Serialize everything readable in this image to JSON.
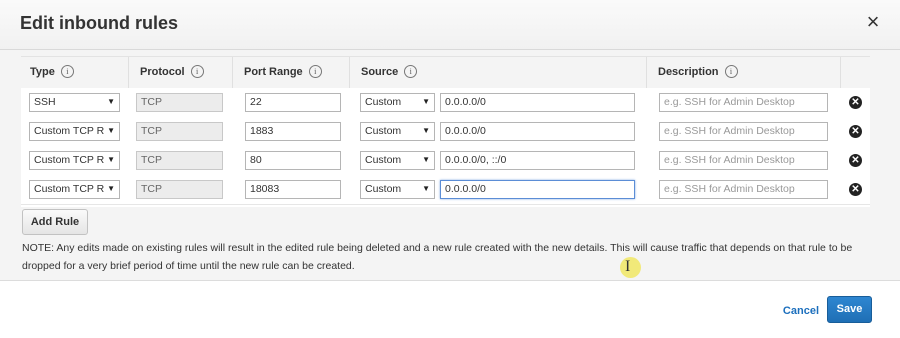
{
  "dialog": {
    "title": "Edit inbound rules",
    "close_icon": "close-icon"
  },
  "table": {
    "headers": {
      "type": "Type",
      "protocol": "Protocol",
      "port_range": "Port Range",
      "source": "Source",
      "description": "Description"
    },
    "rows": [
      {
        "type": "SSH",
        "protocol": "TCP",
        "port_range": "22",
        "source_type": "Custom",
        "source_value": "0.0.0.0/0",
        "description_placeholder": "e.g. SSH for Admin Desktop"
      },
      {
        "type": "Custom TCP R",
        "protocol": "TCP",
        "port_range": "1883",
        "source_type": "Custom",
        "source_value": "0.0.0.0/0",
        "description_placeholder": "e.g. SSH for Admin Desktop"
      },
      {
        "type": "Custom TCP R",
        "protocol": "TCP",
        "port_range": "80",
        "source_type": "Custom",
        "source_value": "0.0.0.0/0, ::/0",
        "description_placeholder": "e.g. SSH for Admin Desktop"
      },
      {
        "type": "Custom TCP R",
        "protocol": "TCP",
        "port_range": "18083",
        "source_type": "Custom",
        "source_value": "0.0.0.0/0",
        "description_placeholder": "e.g. SSH for Admin Desktop"
      }
    ]
  },
  "add_rule_label": "Add Rule",
  "note": "NOTE: Any edits made on existing rules will result in the edited rule being deleted and a new rule created with the new details. This will cause traffic that depends on that rule to be dropped for a very brief period of time until the new rule can be created.",
  "footer": {
    "cancel_label": "Cancel",
    "save_label": "Save"
  },
  "colors": {
    "primary": "#1f6fb5",
    "link": "#1c6fbd"
  }
}
